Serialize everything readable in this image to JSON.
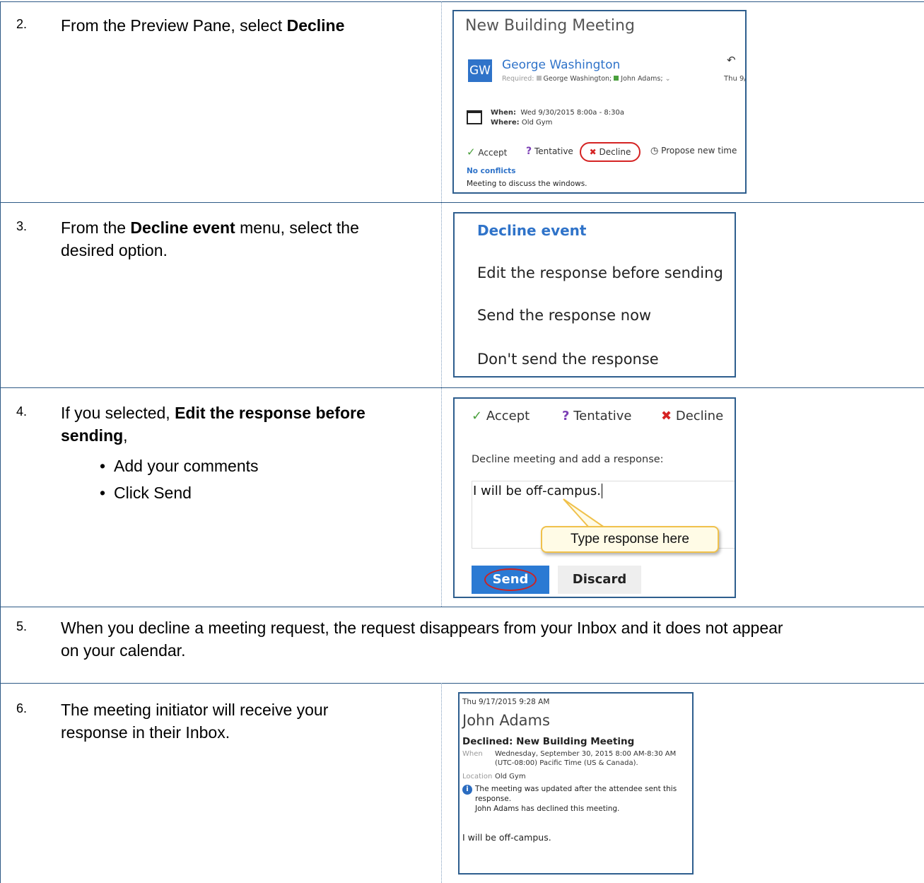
{
  "steps": [
    {
      "num": "2.",
      "text_prefix": "From the Preview Pane, select ",
      "bold": "Decline"
    },
    {
      "num": "3.",
      "prefix": "From the ",
      "bold": "Decline event",
      "suffix_line1": " menu, select the",
      "line2": "desired option."
    },
    {
      "num": "4.",
      "prefix": "If you selected, ",
      "bold1": "Edit the response before",
      "bold2": "sending",
      "comma": ",",
      "bullets": [
        "Add your comments",
        "Click Send"
      ]
    },
    {
      "num": "5.",
      "line1": "When you decline a meeting request, the request disappears from your Inbox and it does not appear",
      "line2": "on your calendar."
    },
    {
      "num": "6.",
      "line1": "The meeting initiator will receive your",
      "line2": "response in their Inbox."
    }
  ],
  "shot1": {
    "title": "New Building Meeting",
    "avatar": "GW",
    "organizer": "George Washington",
    "required_label": "Required:",
    "required_names": "George Washington;",
    "required_names2": "John Adams;",
    "date_short": "Thu 9/",
    "when_label": "When:",
    "when_value": "Wed 9/30/2015 8:00a - 8:30a",
    "where_label": "Where:",
    "where_value": "Old Gym",
    "accept": "Accept",
    "tentative": "Tentative",
    "decline": "Decline",
    "propose": "Propose new time",
    "conflicts": "No conflicts",
    "body": "Meeting to discuss the windows."
  },
  "shot2": {
    "header": "Decline event",
    "options": [
      "Edit the response before sending",
      "Send the response now",
      "Don't send the response"
    ]
  },
  "shot3": {
    "accept": "Accept",
    "tentative": "Tentative",
    "decline": "Decline",
    "prompt": "Decline meeting and add a response:",
    "response": "I will be off-campus.",
    "callout": "Type response here",
    "send": "Send",
    "discard": "Discard"
  },
  "shot4": {
    "timestamp": "Thu 9/17/2015 9:28 AM",
    "sender": "John Adams",
    "subject": "Declined: New Building Meeting",
    "when_label": "When",
    "when_line1": "Wednesday, September 30, 2015 8:00 AM-8:30 AM",
    "when_line2": "(UTC-08:00) Pacific Time (US & Canada).",
    "location_label": "Location",
    "location_value": "Old Gym",
    "info_line1": "The meeting was updated after the attendee sent this",
    "info_line2": "response.",
    "info_line3": "John Adams has declined this meeting.",
    "body": "I will be off-campus."
  },
  "colors": {
    "rule": "#2e5a86",
    "accent": "#2f73c9",
    "send_button": "#2b7ad3",
    "callout_fill": "#fffbe6",
    "callout_border": "#f0c14b",
    "decline_red": "#d52323",
    "accept_green": "#4aa03c",
    "tentative_purple": "#7b3fb5"
  }
}
